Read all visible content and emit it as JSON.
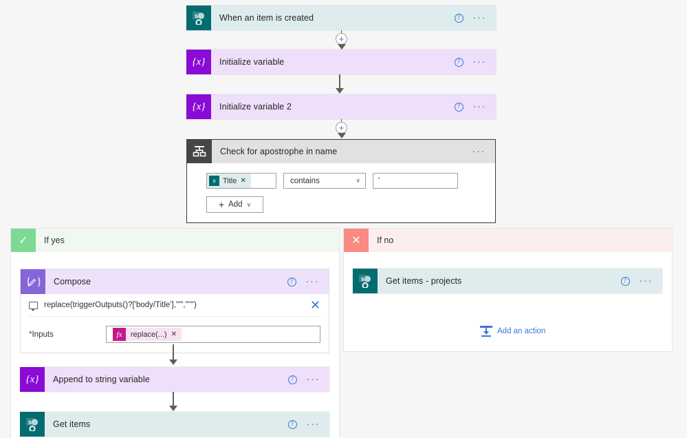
{
  "canvas": {
    "background": "#f6f6f6",
    "accent_blue": "#3b78d8"
  },
  "flow": {
    "trigger": {
      "title": "When an item is created",
      "icon": "sharepoint-icon",
      "icon_glyph": "s",
      "help_label": "?",
      "more_label": "···"
    },
    "steps": [
      {
        "title": "Initialize variable",
        "icon": "variable-icon",
        "icon_glyph": "{x}",
        "help_label": "?",
        "more_label": "···"
      },
      {
        "title": "Initialize variable 2",
        "icon": "variable-icon",
        "icon_glyph": "{x}",
        "help_label": "?",
        "more_label": "···"
      }
    ],
    "insert_button_label": "+"
  },
  "condition": {
    "title": "Check for apostrophe in name",
    "icon": "condition-icon",
    "more_label": "···",
    "row": {
      "token_icon_glyph": "s",
      "token_label": "Title",
      "token_remove_label": "✕",
      "operator": "contains",
      "operator_chevron": "∨",
      "value": "'"
    },
    "add_button": {
      "plus": "+",
      "label": "Add",
      "chevron": "∨"
    }
  },
  "branch_yes": {
    "header_label": "If yes",
    "header_icon": "checkmark-icon",
    "header_glyph": "✓",
    "compose": {
      "title": "Compose",
      "icon": "compose-icon",
      "icon_glyph": "{✎}",
      "help_label": "?",
      "more_label": "···",
      "formula_text": "replace(triggerOutputs()?['body/Title'],\"'\",\"''\")",
      "formula_close_label": "✕",
      "inputs_label": "Inputs",
      "inputs_required_marker": "*",
      "inputs_token": {
        "fx_glyph": "fx",
        "label": "replace(...)",
        "remove_label": "✕"
      }
    },
    "actions": [
      {
        "title": "Append to string variable",
        "icon": "variable-icon",
        "icon_glyph": "{x}",
        "help_label": "?",
        "more_label": "···"
      },
      {
        "title": "Get items",
        "icon": "sharepoint-icon",
        "icon_glyph": "s",
        "help_label": "?",
        "more_label": "···"
      }
    ]
  },
  "branch_no": {
    "header_label": "If no",
    "header_icon": "close-icon",
    "header_glyph": "✕",
    "actions": [
      {
        "title": "Get items - projects",
        "icon": "sharepoint-icon",
        "icon_glyph": "s",
        "help_label": "?",
        "more_label": "···"
      }
    ],
    "add_action_label": "Add an action"
  }
}
